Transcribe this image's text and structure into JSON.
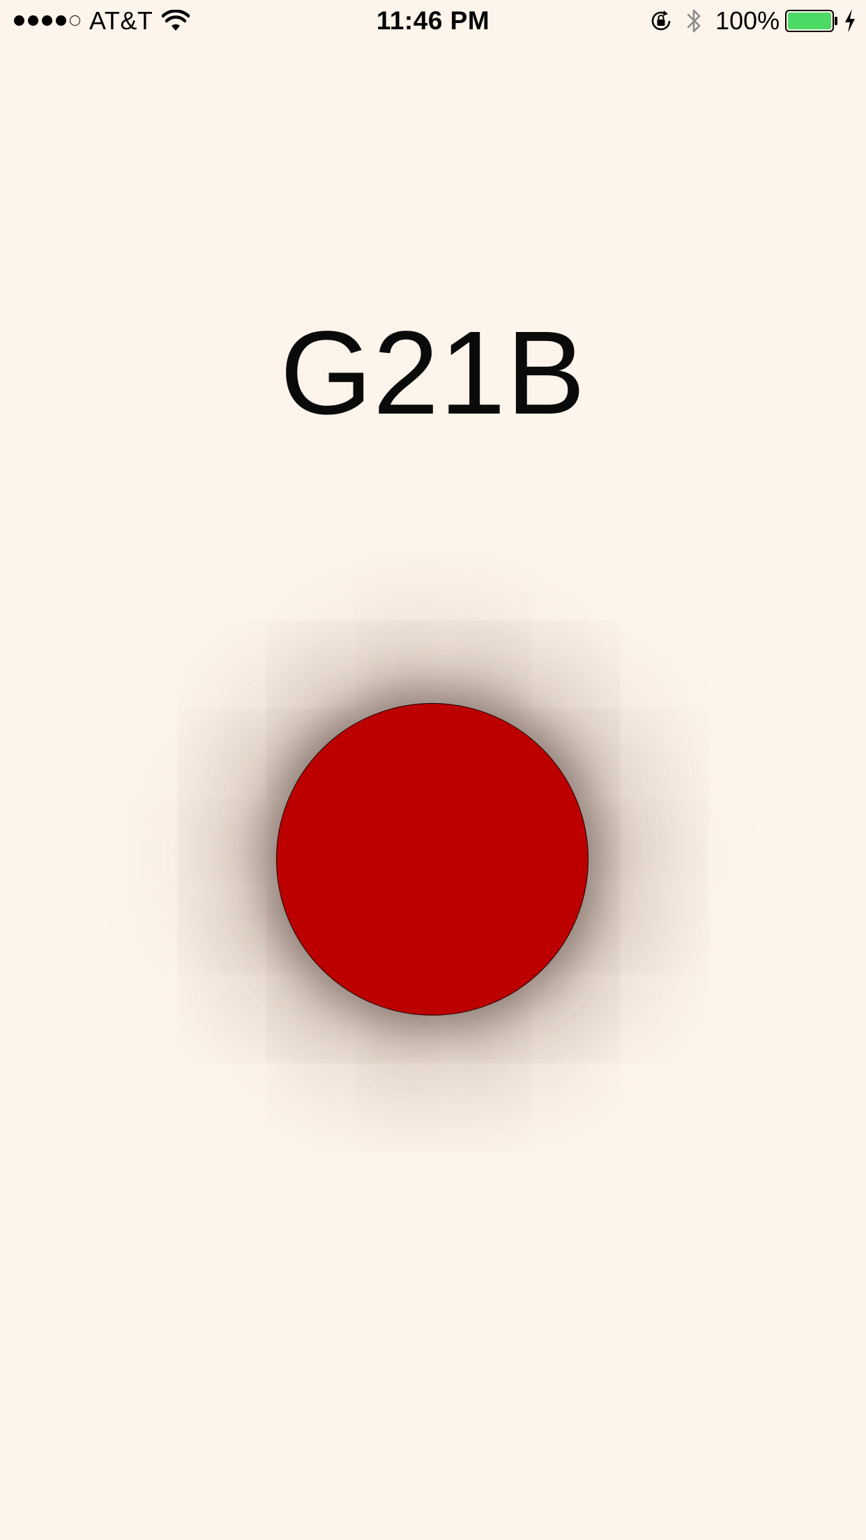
{
  "status_bar": {
    "signal_strength": 4,
    "signal_max": 5,
    "carrier": "AT&T",
    "time": "11:46 PM",
    "battery_percent": "100%",
    "battery_level": 1.0,
    "battery_color": "#4cd964",
    "icons": [
      "wifi-icon",
      "lock-rotation-icon",
      "bluetooth-icon",
      "battery-icon",
      "charging-icon"
    ]
  },
  "main": {
    "code": "G21B",
    "button_color": "#bc0000",
    "background_color": "#fdf4eb"
  }
}
